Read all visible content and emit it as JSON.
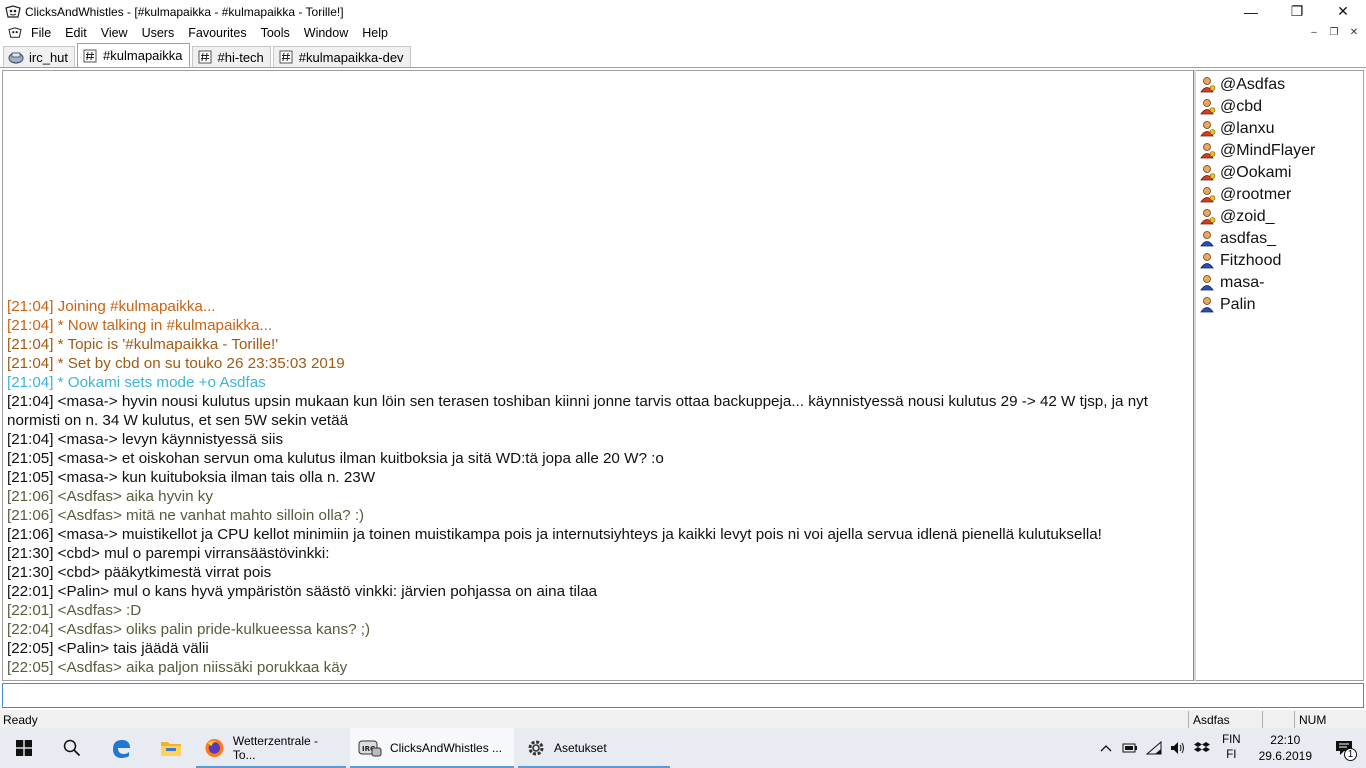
{
  "window": {
    "title": "ClicksAndWhistles - [#kulmapaikka - #kulmapaikka - Torille!]",
    "min_glyph": "—",
    "max_glyph": "❐",
    "close_glyph": "✕",
    "mdi_min": "–",
    "mdi_restore": "❐",
    "mdi_close": "✕"
  },
  "menu": {
    "items": [
      "File",
      "Edit",
      "View",
      "Users",
      "Favourites",
      "Tools",
      "Window",
      "Help"
    ]
  },
  "tabs": [
    {
      "label": "irc_hut",
      "active": false
    },
    {
      "label": "#kulmapaikka",
      "active": true
    },
    {
      "label": "#hi-tech",
      "active": false
    },
    {
      "label": "#kulmapaikka-dev",
      "active": false
    }
  ],
  "chat": {
    "lines": [
      {
        "kind": "sys",
        "text": "[21:04] Joining #kulmapaikka..."
      },
      {
        "kind": "sys",
        "text": "[21:04] * Now talking in #kulmapaikka..."
      },
      {
        "kind": "topic",
        "text": "[21:04] * Topic is '#kulmapaikka - Torille!'"
      },
      {
        "kind": "topic",
        "text": "[21:04] * Set by cbd on su touko 26 23:35:03 2019"
      },
      {
        "kind": "mode",
        "text": "[21:04] * Ookami sets mode +o Asdfas"
      },
      {
        "kind": "msg",
        "text": "[21:04] <masa-> hyvin nousi kulutus upsin mukaan kun löin sen terasen toshiban kiinni jonne tarvis ottaa backuppeja... käynnistyessä nousi kulutus 29 -> 42 W tjsp, ja nyt normisti on n. 34 W kulutus, et sen 5W sekin vetää"
      },
      {
        "kind": "msg",
        "text": "[21:04] <masa-> levyn käynnistyessä siis"
      },
      {
        "kind": "msg",
        "text": "[21:05] <masa-> et oiskohan servun oma kulutus ilman kuitboksia ja sitä WD:tä jopa alle 20 W? :o"
      },
      {
        "kind": "msg",
        "text": "[21:05] <masa-> kun kuituboksia ilman tais olla n. 23W"
      },
      {
        "kind": "self",
        "text": "[21:06] <Asdfas> aika hyvin ky"
      },
      {
        "kind": "self",
        "text": "[21:06] <Asdfas> mitä ne vanhat mahto silloin olla? :)"
      },
      {
        "kind": "msg",
        "text": "[21:06] <masa-> muistikellot ja CPU kellot minimiin ja toinen muistikampa pois ja internutsiyhteys ja kaikki levyt pois ni voi ajella servua idlenä pienellä kulutuksella!"
      },
      {
        "kind": "msg",
        "text": "[21:30] <cbd> mul o parempi virransäästövinkki:"
      },
      {
        "kind": "msg",
        "text": "[21:30] <cbd> pääkytkimestä virrat pois"
      },
      {
        "kind": "msg",
        "text": "[22:01] <Palin> mul o kans hyvä ympäristön säästö vinkki: järvien pohjassa on aina tilaa"
      },
      {
        "kind": "self",
        "text": "[22:01] <Asdfas> :D"
      },
      {
        "kind": "self",
        "text": "[22:04] <Asdfas> oliks palin pride-kulkueessa kans? ;)"
      },
      {
        "kind": "msg",
        "text": "[22:05] <Palin> tais jäädä välii"
      },
      {
        "kind": "self",
        "text": "[22:05] <Asdfas> aika paljon niissäki porukkaa käy"
      }
    ]
  },
  "users": [
    {
      "nick": "@Asdfas",
      "op": true
    },
    {
      "nick": "@cbd",
      "op": true
    },
    {
      "nick": "@lanxu",
      "op": true
    },
    {
      "nick": "@MindFlayer",
      "op": true
    },
    {
      "nick": "@Ookami",
      "op": true
    },
    {
      "nick": "@rootmer",
      "op": true
    },
    {
      "nick": "@zoid_",
      "op": true
    },
    {
      "nick": "asdfas_",
      "op": false
    },
    {
      "nick": "Fitzhood",
      "op": false
    },
    {
      "nick": "masa-",
      "op": false
    },
    {
      "nick": "Palin",
      "op": false
    }
  ],
  "input": {
    "value": ""
  },
  "status": {
    "ready": "Ready",
    "nick": "Asdfas",
    "num": "NUM"
  },
  "taskbar": {
    "apps": [
      {
        "label": "Wetterzentrale - To...",
        "icon": "firefox-icon",
        "active": false
      },
      {
        "label": "ClicksAndWhistles ...",
        "icon": "irc-icon",
        "active": true
      },
      {
        "label": "Asetukset",
        "icon": "gear-icon",
        "active": false
      }
    ],
    "lang_top": "FIN",
    "lang_bottom": "FI",
    "time": "22:10",
    "date": "29.6.2019",
    "notif_count": "1"
  },
  "colors": {
    "sys": "#c86414",
    "topic": "#a05a14",
    "mode": "#3cb4dc",
    "self": "#5a5a3c",
    "accent": "#3c8cdc"
  }
}
